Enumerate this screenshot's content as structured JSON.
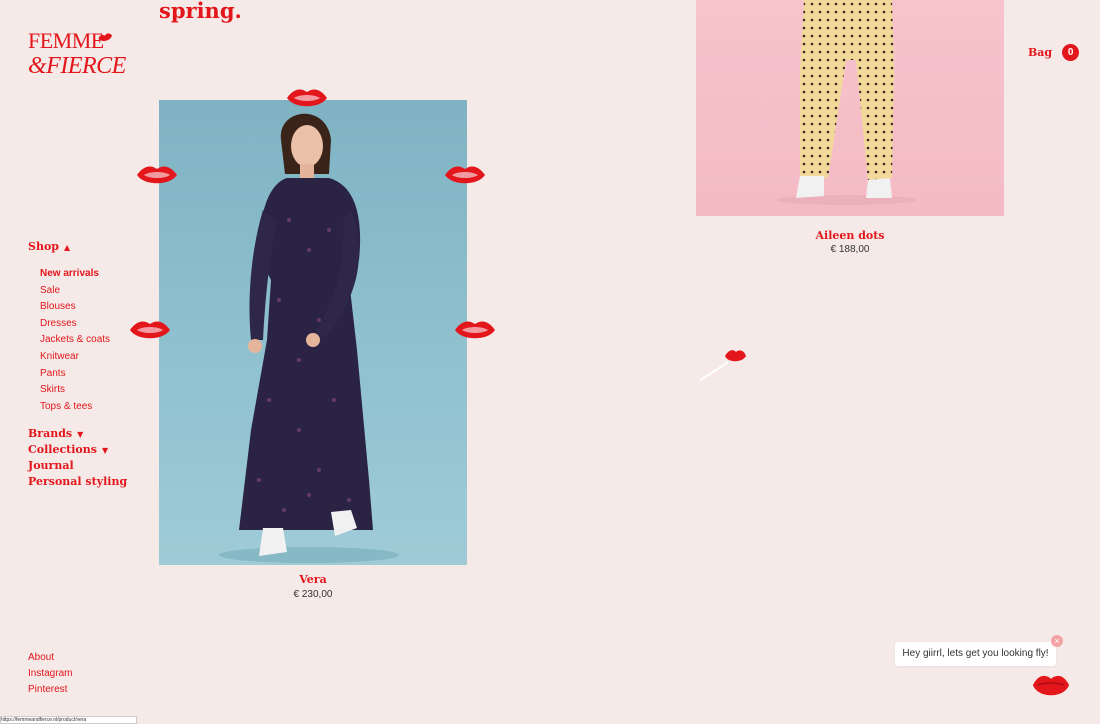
{
  "header": {
    "section_title": "spring."
  },
  "logo": {
    "line1": "FEMME",
    "line2": "&FIERCE"
  },
  "bag": {
    "label": "Bag",
    "count": "0"
  },
  "nav": {
    "shop": "Shop",
    "shop_items": [
      "New arrivals",
      "Sale",
      "Blouses",
      "Dresses",
      "Jackets & coats",
      "Knitwear",
      "Pants",
      "Skirts",
      "Tops & tees"
    ],
    "brands": "Brands",
    "collections": "Collections",
    "journal": "Journal",
    "personal_styling": "Personal styling"
  },
  "products": [
    {
      "name": "Vera",
      "price": "€ 230,00"
    },
    {
      "name": "Aileen dots",
      "price": "€ 188,00"
    }
  ],
  "footer": {
    "links": [
      "About",
      "Instagram",
      "Pinterest"
    ]
  },
  "chat": {
    "message": "Hey giirrl, lets get you looking fly!",
    "close": "×"
  },
  "status_bar": {
    "url": "https://femmeandfierce.nl/product/vera"
  },
  "colors": {
    "accent": "#e3161b",
    "background": "#f5eae8"
  }
}
